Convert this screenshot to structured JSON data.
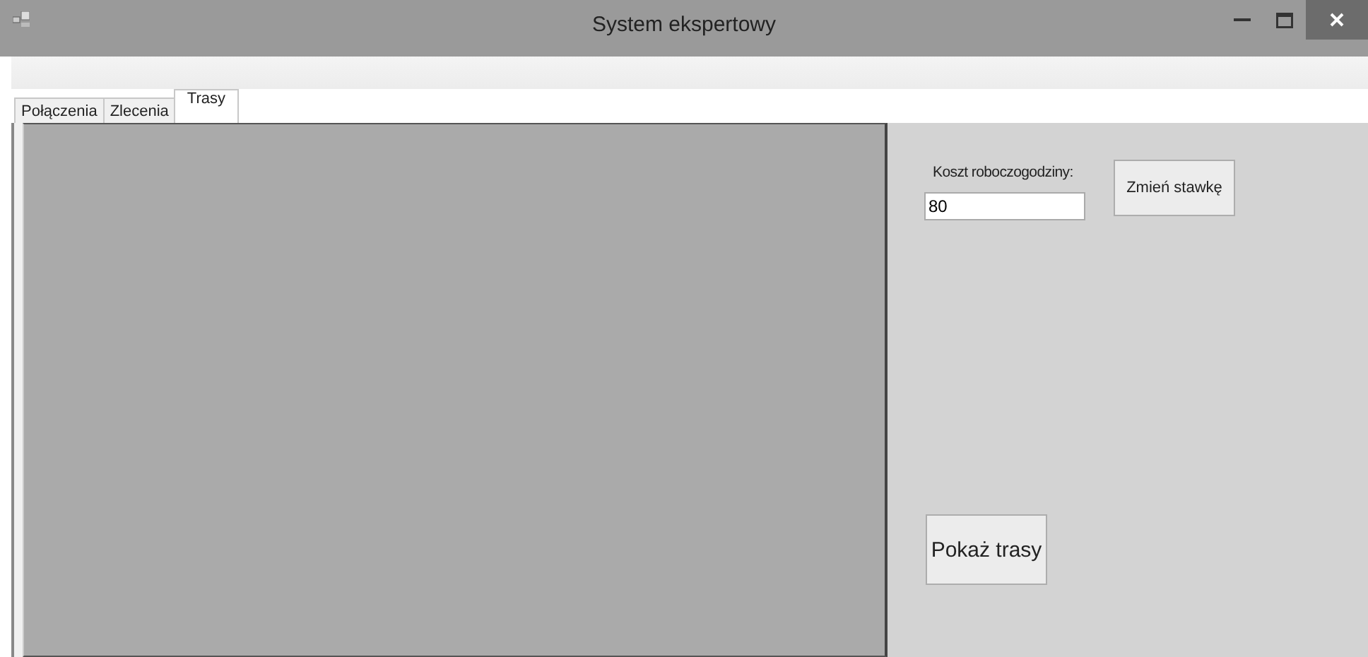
{
  "window": {
    "title": "System ekspertowy"
  },
  "tabs": [
    {
      "label": "Połączenia",
      "selected": false
    },
    {
      "label": "Zlecenia",
      "selected": false
    },
    {
      "label": "Trasy",
      "selected": true
    }
  ],
  "rate": {
    "label": "Koszt roboczogodziny:",
    "value": "80",
    "button": "Zmień stawkę"
  },
  "show_button": "Pokaż trasy"
}
